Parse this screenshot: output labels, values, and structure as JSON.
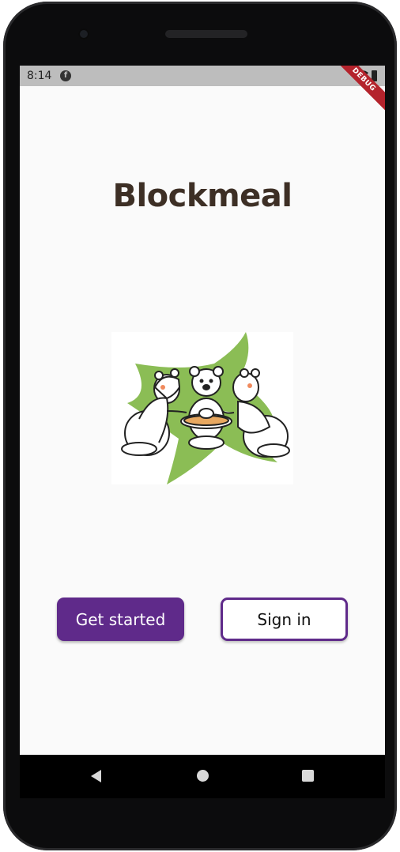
{
  "status_bar": {
    "time": "8:14",
    "notification_icon": "flutter-notification-icon",
    "right_icons": [
      "wifi-icon",
      "battery-icon"
    ],
    "debug_banner": "DEBUG",
    "debug_color": "#b4232c"
  },
  "app": {
    "title": "Blockmeal",
    "title_color": "#3d2f25",
    "illustration_icon": "three-animals-eating-illustration"
  },
  "buttons": {
    "primary_label": "Get started",
    "secondary_label": "Sign in",
    "accent_color": "#5f2a8a"
  },
  "nav_bar": {
    "icons": [
      "back-icon",
      "home-icon",
      "recents-icon"
    ]
  }
}
